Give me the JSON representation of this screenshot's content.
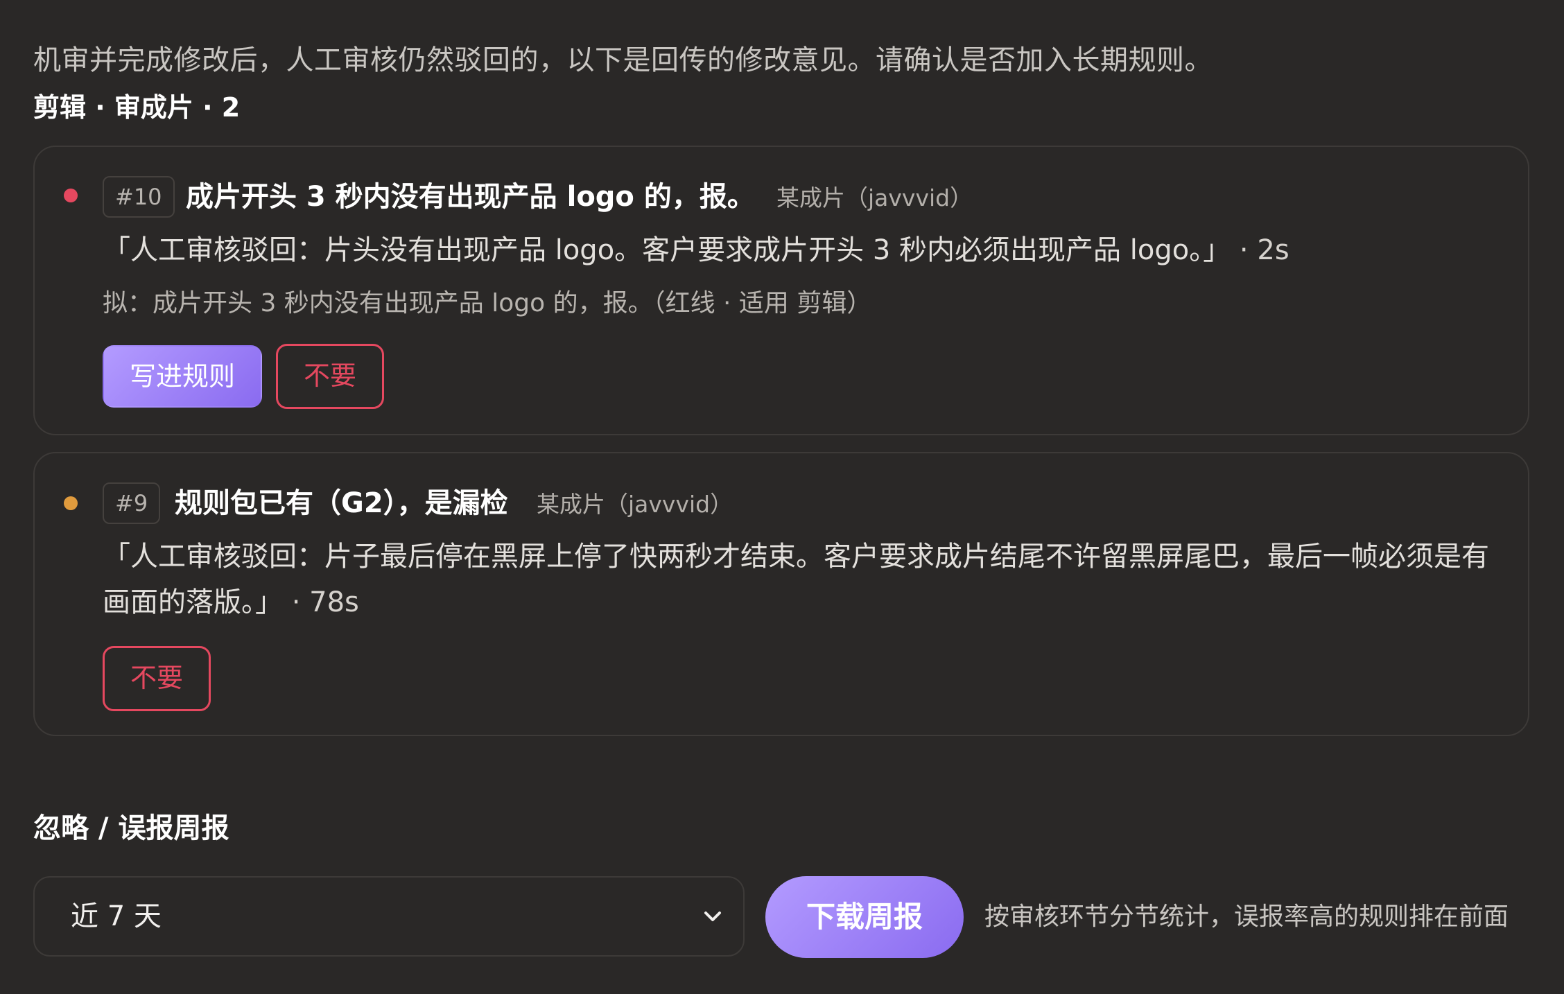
{
  "intro": "机审并完成修改后，人工审核仍然驳回的，以下是回传的修改意见。请确认是否加入长期规则。",
  "group_title": "剪辑 · 审成片 · 2",
  "cards": [
    {
      "id": "#10",
      "status_color": "#e5485f",
      "title": "成片开头 3 秒内没有出现产品 logo 的，报。",
      "source": "某成片（javvvid）",
      "quote": "「人工审核驳回：片头没有出现产品 logo。客户要求成片开头 3 秒内必须出现产品 logo。」",
      "duration": " · 2s",
      "proposal": "拟：成片开头 3 秒内没有出现产品 logo 的，报。（红线 · 适用 剪辑）",
      "accept_label": "写进规则",
      "reject_label": "不要"
    },
    {
      "id": "#9",
      "status_color": "#e09b3d",
      "title": "规则包已有（G2），是漏检",
      "source": "某成片（javvvid）",
      "quote": "「人工审核驳回：片子最后停在黑屏上停了快两秒才结束。客户要求成片结尾不许留黑屏尾巴，最后一帧必须是有画面的落版。」",
      "duration": " · 78s",
      "reject_label": "不要"
    }
  ],
  "report": {
    "title": "忽略 / 误报周报",
    "period_selected": "近 7 天",
    "download_label": "下载周报",
    "hint": "按审核环节分节统计，误报率高的规则排在前面"
  },
  "colors": {
    "accent_gradient_start": "#b39bff",
    "accent_gradient_end": "#8a6bf0",
    "danger": "#e5485f",
    "warning": "#e09b3d",
    "background": "#2a2827"
  }
}
